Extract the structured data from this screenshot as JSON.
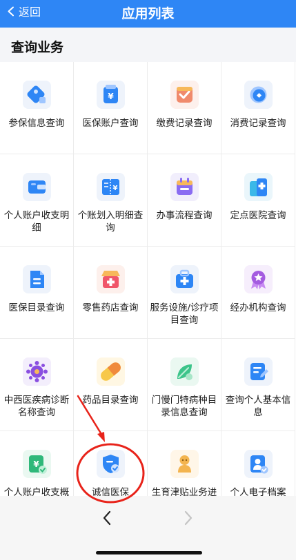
{
  "header": {
    "back_label": "返回",
    "title": "应用列表"
  },
  "section": {
    "title": "查询业务"
  },
  "items": [
    {
      "label": "参保信息查询",
      "icon": "insured-tag-icon"
    },
    {
      "label": "医保账户查询",
      "icon": "yuan-wallet-icon"
    },
    {
      "label": "缴费记录查询",
      "icon": "payment-record-icon"
    },
    {
      "label": "消费记录查询",
      "icon": "coin-icon"
    },
    {
      "label": "个人账户收支明细",
      "icon": "wallet-card-icon"
    },
    {
      "label": "个账划入明细查询",
      "icon": "yuan-ticket-icon"
    },
    {
      "label": "办事流程查询",
      "icon": "calendar-icon"
    },
    {
      "label": "定点医院查询",
      "icon": "hospital-building-icon"
    },
    {
      "label": "医保目录查询",
      "icon": "document-icon"
    },
    {
      "label": "零售药店查询",
      "icon": "pharmacy-icon"
    },
    {
      "label": "服务设施/诊疗项目查询",
      "icon": "medical-kit-icon"
    },
    {
      "label": "经办机构查询",
      "icon": "badge-award-icon"
    },
    {
      "label": "中西医疾病诊断名称查询",
      "icon": "virus-icon"
    },
    {
      "label": "药品目录查询",
      "icon": "capsule-icon"
    },
    {
      "label": "门慢门特病种目录信息查询",
      "icon": "leaf-icon"
    },
    {
      "label": "查询个人基本信息",
      "icon": "profile-document-icon"
    },
    {
      "label": "个人账户收支概",
      "icon": "yuan-doc-check-icon"
    },
    {
      "label": "诚信医保",
      "icon": "shield-check-icon"
    },
    {
      "label": "生育津贴业务进",
      "icon": "baby-icon"
    },
    {
      "label": "个人电子档案",
      "icon": "person-archive-icon"
    }
  ],
  "colors": {
    "primary": "#2e86f5",
    "annotation": "#e8231a"
  }
}
